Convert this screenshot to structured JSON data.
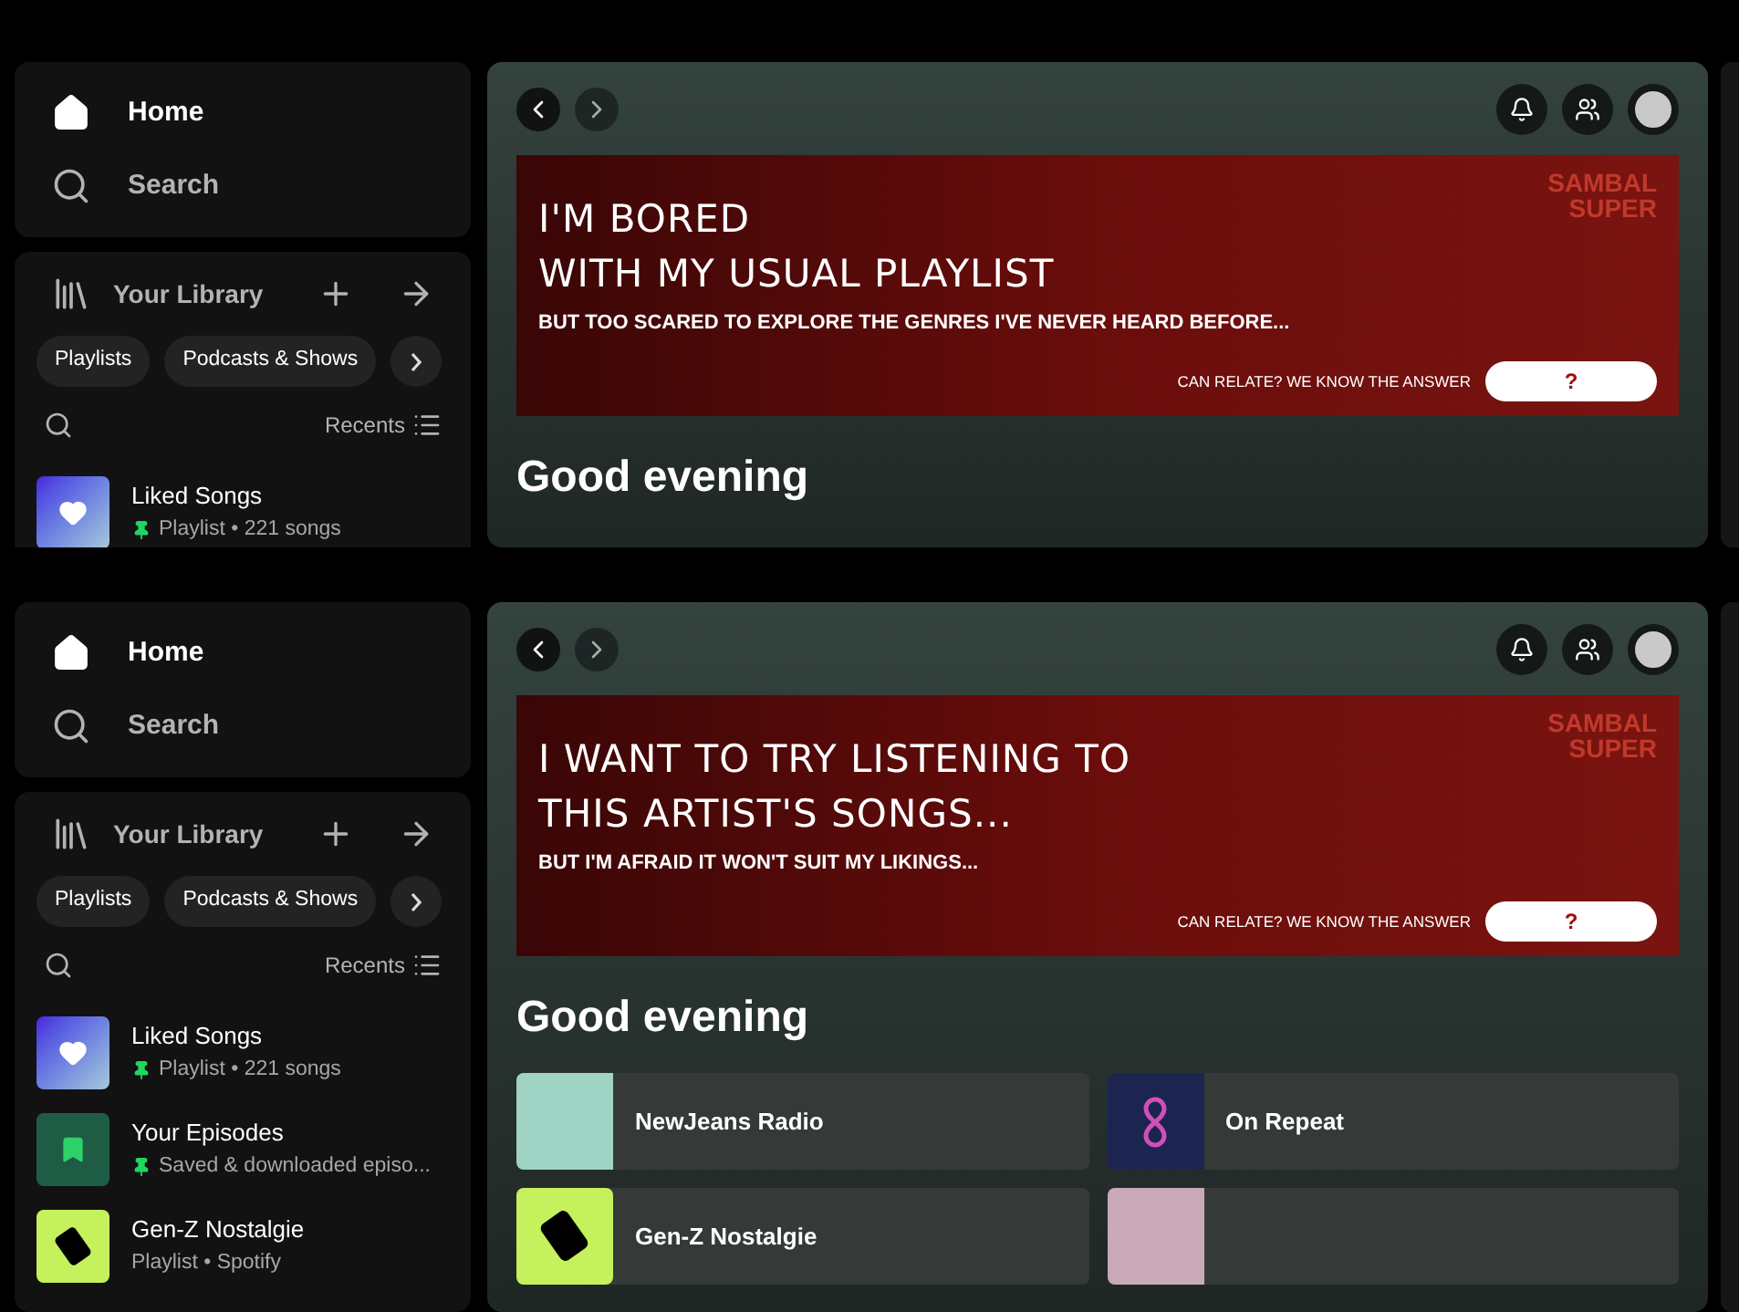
{
  "screens": [
    {
      "nav": [
        {
          "kind": "home",
          "label": "Home",
          "selected": true
        },
        {
          "kind": "search",
          "label": "Search",
          "selected": false
        }
      ],
      "library": {
        "title": "Your Library",
        "chips": [
          "Playlists",
          "Podcasts & Shows"
        ],
        "sort": "Recents",
        "items": [
          {
            "kind": "liked",
            "title": "Liked Songs",
            "subtitle": "Playlist • 221 songs",
            "pinned": true
          }
        ]
      },
      "banner": {
        "headline": [
          "I'M BORED",
          "WITH MY USUAL PLAYLIST"
        ],
        "subline": "BUT TOO SCARED TO EXPLORE THE GENRES I'VE NEVER HEARD BEFORE...",
        "brand": [
          "SAMBAL",
          "SUPER"
        ],
        "prompt": "CAN RELATE? WE KNOW THE ANSWER",
        "button": "?"
      },
      "greeting": "Good evening"
    },
    {
      "nav": [
        {
          "kind": "home",
          "label": "Home",
          "selected": true
        },
        {
          "kind": "search",
          "label": "Search",
          "selected": false
        }
      ],
      "library": {
        "title": "Your Library",
        "chips": [
          "Playlists",
          "Podcasts & Shows"
        ],
        "sort": "Recents",
        "items": [
          {
            "kind": "liked",
            "title": "Liked Songs",
            "subtitle": "Playlist • 221 songs",
            "pinned": true
          },
          {
            "kind": "episodes",
            "title": "Your Episodes",
            "subtitle": "Saved & downloaded episo...",
            "pinned": true
          },
          {
            "kind": "playlist",
            "title": "Gen-Z Nostalgie",
            "subtitle": "Playlist • Spotify",
            "pinned": false
          }
        ]
      },
      "banner": {
        "headline": [
          "I WANT TO TRY LISTENING TO",
          "THIS ARTIST'S SONGS..."
        ],
        "subline": "BUT I'M AFRAID IT WON'T SUIT MY LIKINGS...",
        "brand": [
          "SAMBAL",
          "SUPER"
        ],
        "prompt": "CAN RELATE? WE KNOW THE ANSWER",
        "button": "?"
      },
      "greeting": "Good evening",
      "shortcuts": [
        {
          "kind": "radio",
          "title": "NewJeans Radio"
        },
        {
          "kind": "repeat",
          "title": "On Repeat"
        },
        {
          "kind": "playlist",
          "title": "Gen-Z Nostalgie"
        },
        {
          "kind": "mix"
        }
      ]
    }
  ]
}
